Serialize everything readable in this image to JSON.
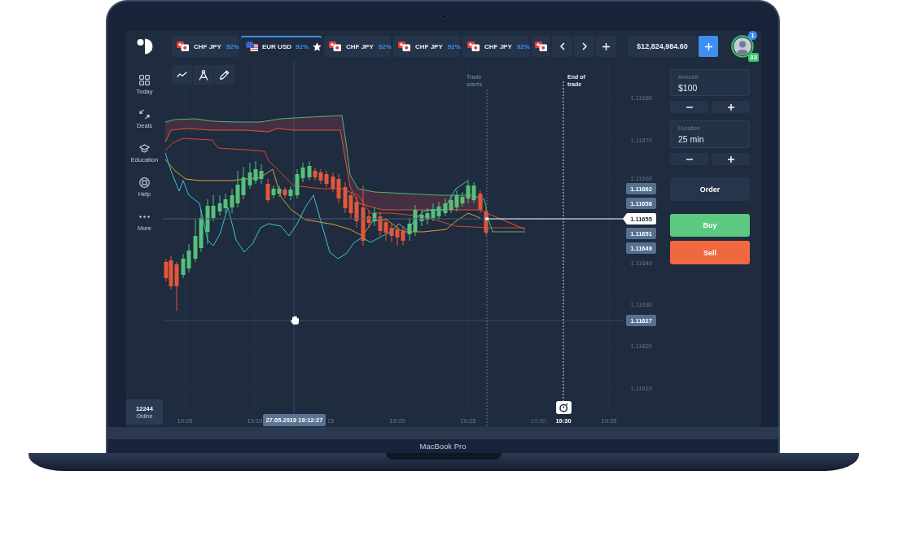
{
  "device": {
    "label": "MacBook Pro"
  },
  "top_bar": {
    "tabs": [
      {
        "kind": "chfjpy",
        "label": "CHF JPY",
        "payout": "92%",
        "selected": false
      },
      {
        "kind": "eurusd",
        "label": "EUR USD",
        "payout": "92%",
        "selected": true
      },
      {
        "kind": "chfjpy",
        "label": "CHF JPY",
        "payout": "92%",
        "selected": false
      },
      {
        "kind": "chfjpy",
        "label": "CHF JPY",
        "payout": "92%",
        "selected": false
      },
      {
        "kind": "chfjpy",
        "label": "CHF JPY",
        "payout": "92%",
        "selected": false
      },
      {
        "kind": "chfjpy",
        "selected": false
      }
    ],
    "balance": "$12,824,984.60",
    "avatar": {
      "notifications": "1",
      "level_badge": "33"
    }
  },
  "sidebar": {
    "items": [
      {
        "kind": "today",
        "label": "Today"
      },
      {
        "kind": "deals",
        "label": "Deals"
      },
      {
        "kind": "education",
        "label": "Education"
      },
      {
        "kind": "help",
        "label": "Help"
      },
      {
        "kind": "more",
        "label": "More"
      }
    ],
    "online": {
      "count": "12244",
      "label": "Online"
    }
  },
  "chart": {
    "trade_start_label": "Trade starts",
    "trade_end_label": "End of trade",
    "price_axis": [
      "1.11680",
      "1.11670",
      "1.11660",
      "1.11640",
      "1.11630",
      "1.11620",
      "1.11610"
    ],
    "price_tags": [
      {
        "kind": "level",
        "value": "1.11662"
      },
      {
        "kind": "level",
        "value": "1.11658"
      },
      {
        "kind": "current",
        "value": "1.11655"
      },
      {
        "kind": "level",
        "value": "1.11651"
      },
      {
        "kind": "level",
        "value": "1.11649"
      },
      {
        "kind": "level",
        "value": "1.11627"
      }
    ],
    "time_axis": [
      {
        "kind": "tick",
        "label": "19:05"
      },
      {
        "kind": "tick",
        "label": "19:10"
      },
      {
        "kind": "tick",
        "label": "15"
      },
      {
        "kind": "tick",
        "label": "19:20"
      },
      {
        "kind": "tick",
        "label": "19:25"
      },
      {
        "kind": "faded",
        "label": "19:30"
      },
      {
        "kind": "expiry",
        "label": "19:30"
      },
      {
        "kind": "tick",
        "label": "19:35"
      }
    ],
    "crosshair_time": "27.05.2019 19:12:27"
  },
  "trade_panel": {
    "amount": {
      "label": "Amount",
      "value": "$100"
    },
    "duration": {
      "label": "Duration",
      "value": "25 min"
    },
    "buttons": [
      {
        "kind": "order",
        "label": "Order"
      },
      {
        "kind": "buy",
        "label": "Buy"
      },
      {
        "kind": "sell",
        "label": "Sell"
      }
    ]
  }
}
